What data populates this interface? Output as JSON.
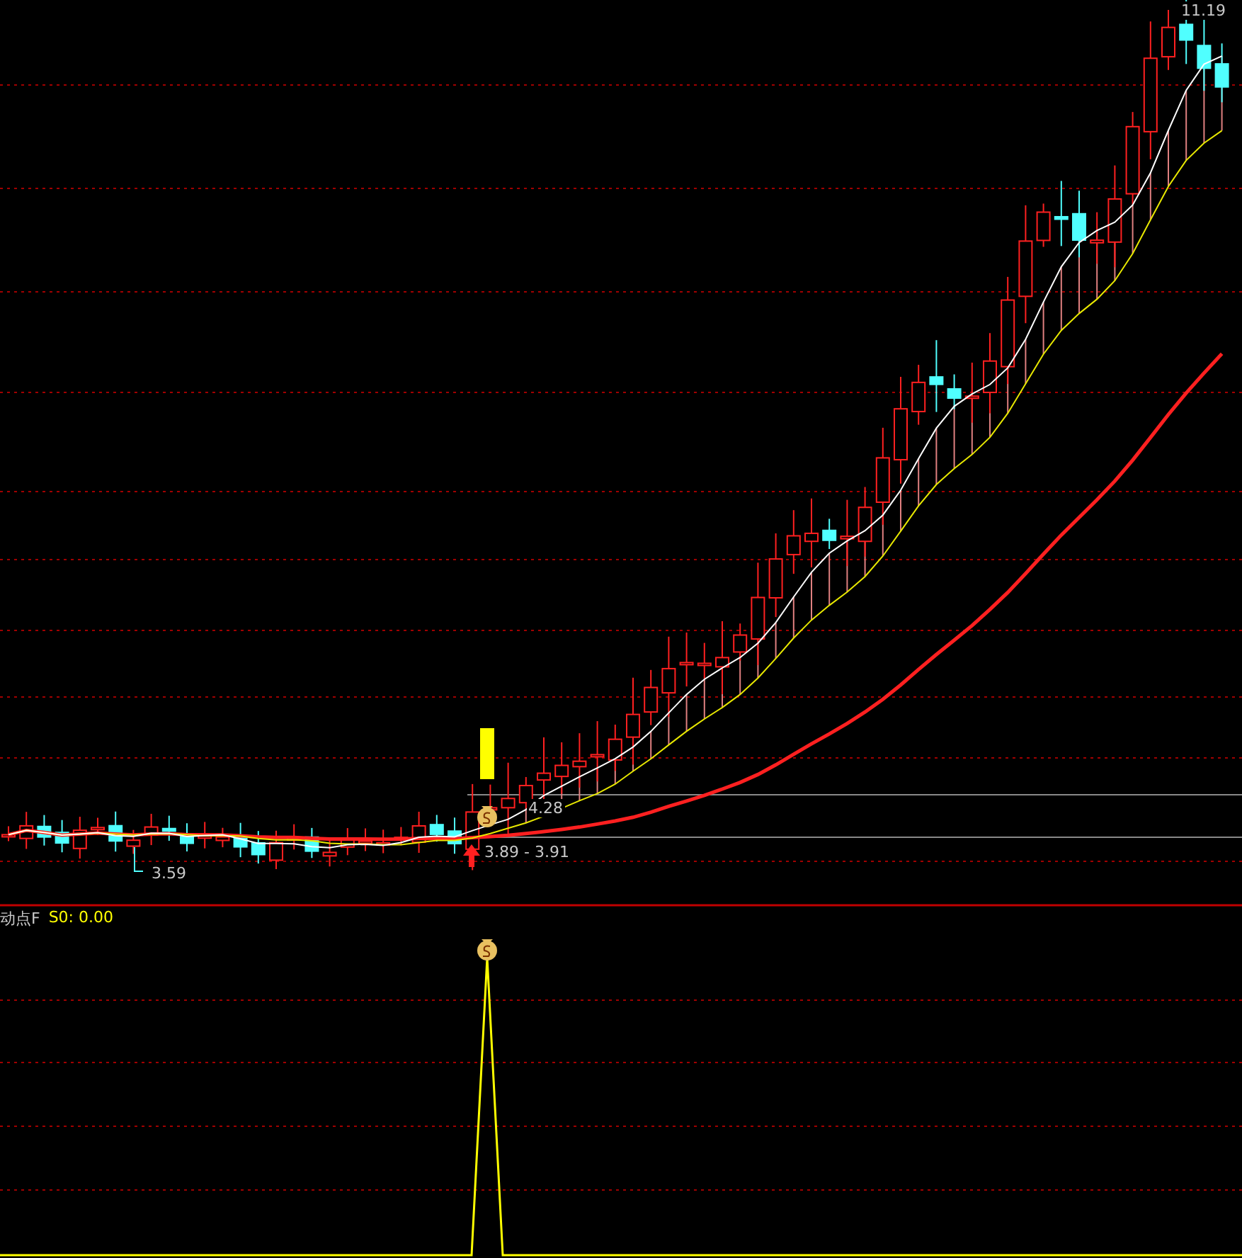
{
  "main_panel": {
    "high_label": "11.19",
    "low_label": "3.59",
    "upper_range_label": "4.28",
    "lower_range_label": "3.89 - 3.91"
  },
  "indicator_panel": {
    "name": "动点F",
    "series_label": "S0: 0.00"
  }
}
